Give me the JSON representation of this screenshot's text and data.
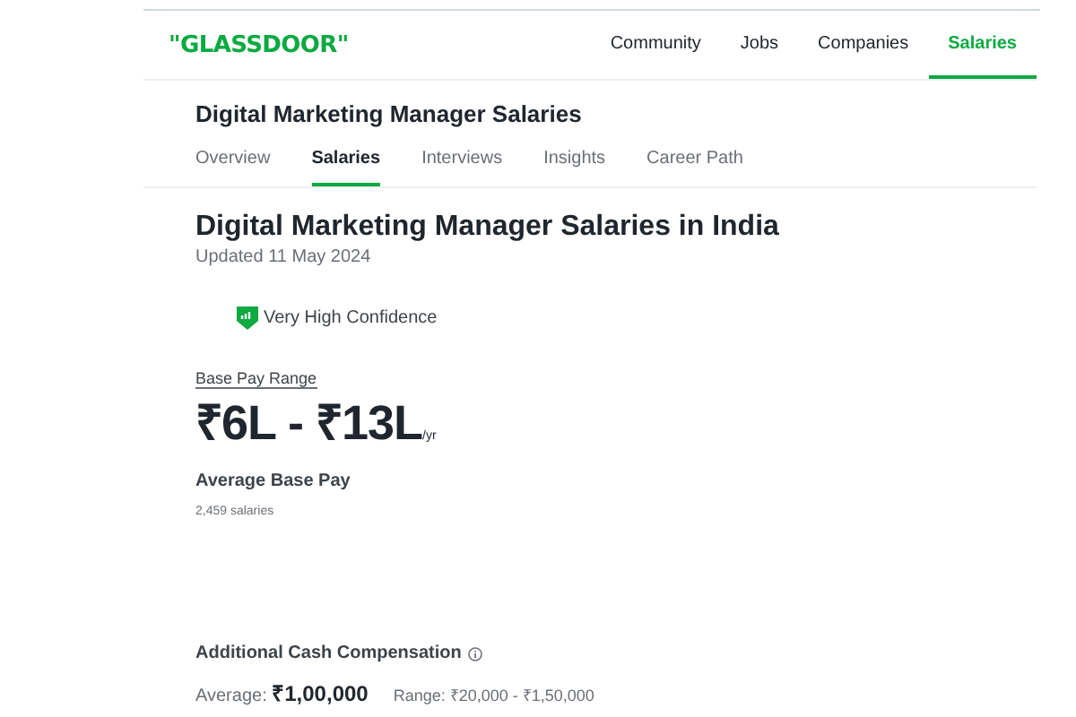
{
  "header": {
    "logo": "\"GLASSDOOR\"",
    "nav": [
      {
        "label": "Community",
        "selected": false
      },
      {
        "label": "Jobs",
        "selected": false
      },
      {
        "label": "Companies",
        "selected": false
      },
      {
        "label": "Salaries",
        "selected": true
      }
    ]
  },
  "page_title": "Digital Marketing Manager Salaries",
  "tabs": [
    {
      "label": "Overview",
      "selected": false
    },
    {
      "label": "Salaries",
      "selected": true
    },
    {
      "label": "Interviews",
      "selected": false
    },
    {
      "label": "Insights",
      "selected": false
    },
    {
      "label": "Career Path",
      "selected": false
    }
  ],
  "heading": "Digital Marketing Manager Salaries in India",
  "updated": "Updated 11 May 2024",
  "confidence": "Very High Confidence",
  "base_pay": {
    "label": "Base Pay Range",
    "range": "₹6L - ₹13L",
    "unit": "/yr",
    "caption": "Average Base Pay",
    "count": "2,459 salaries"
  },
  "additional": {
    "title": "Additional Cash Compensation",
    "average": "Average: **₹1,00,000**",
    "range": "Range: ₹20,000 - ₹1,50,000"
  }
}
